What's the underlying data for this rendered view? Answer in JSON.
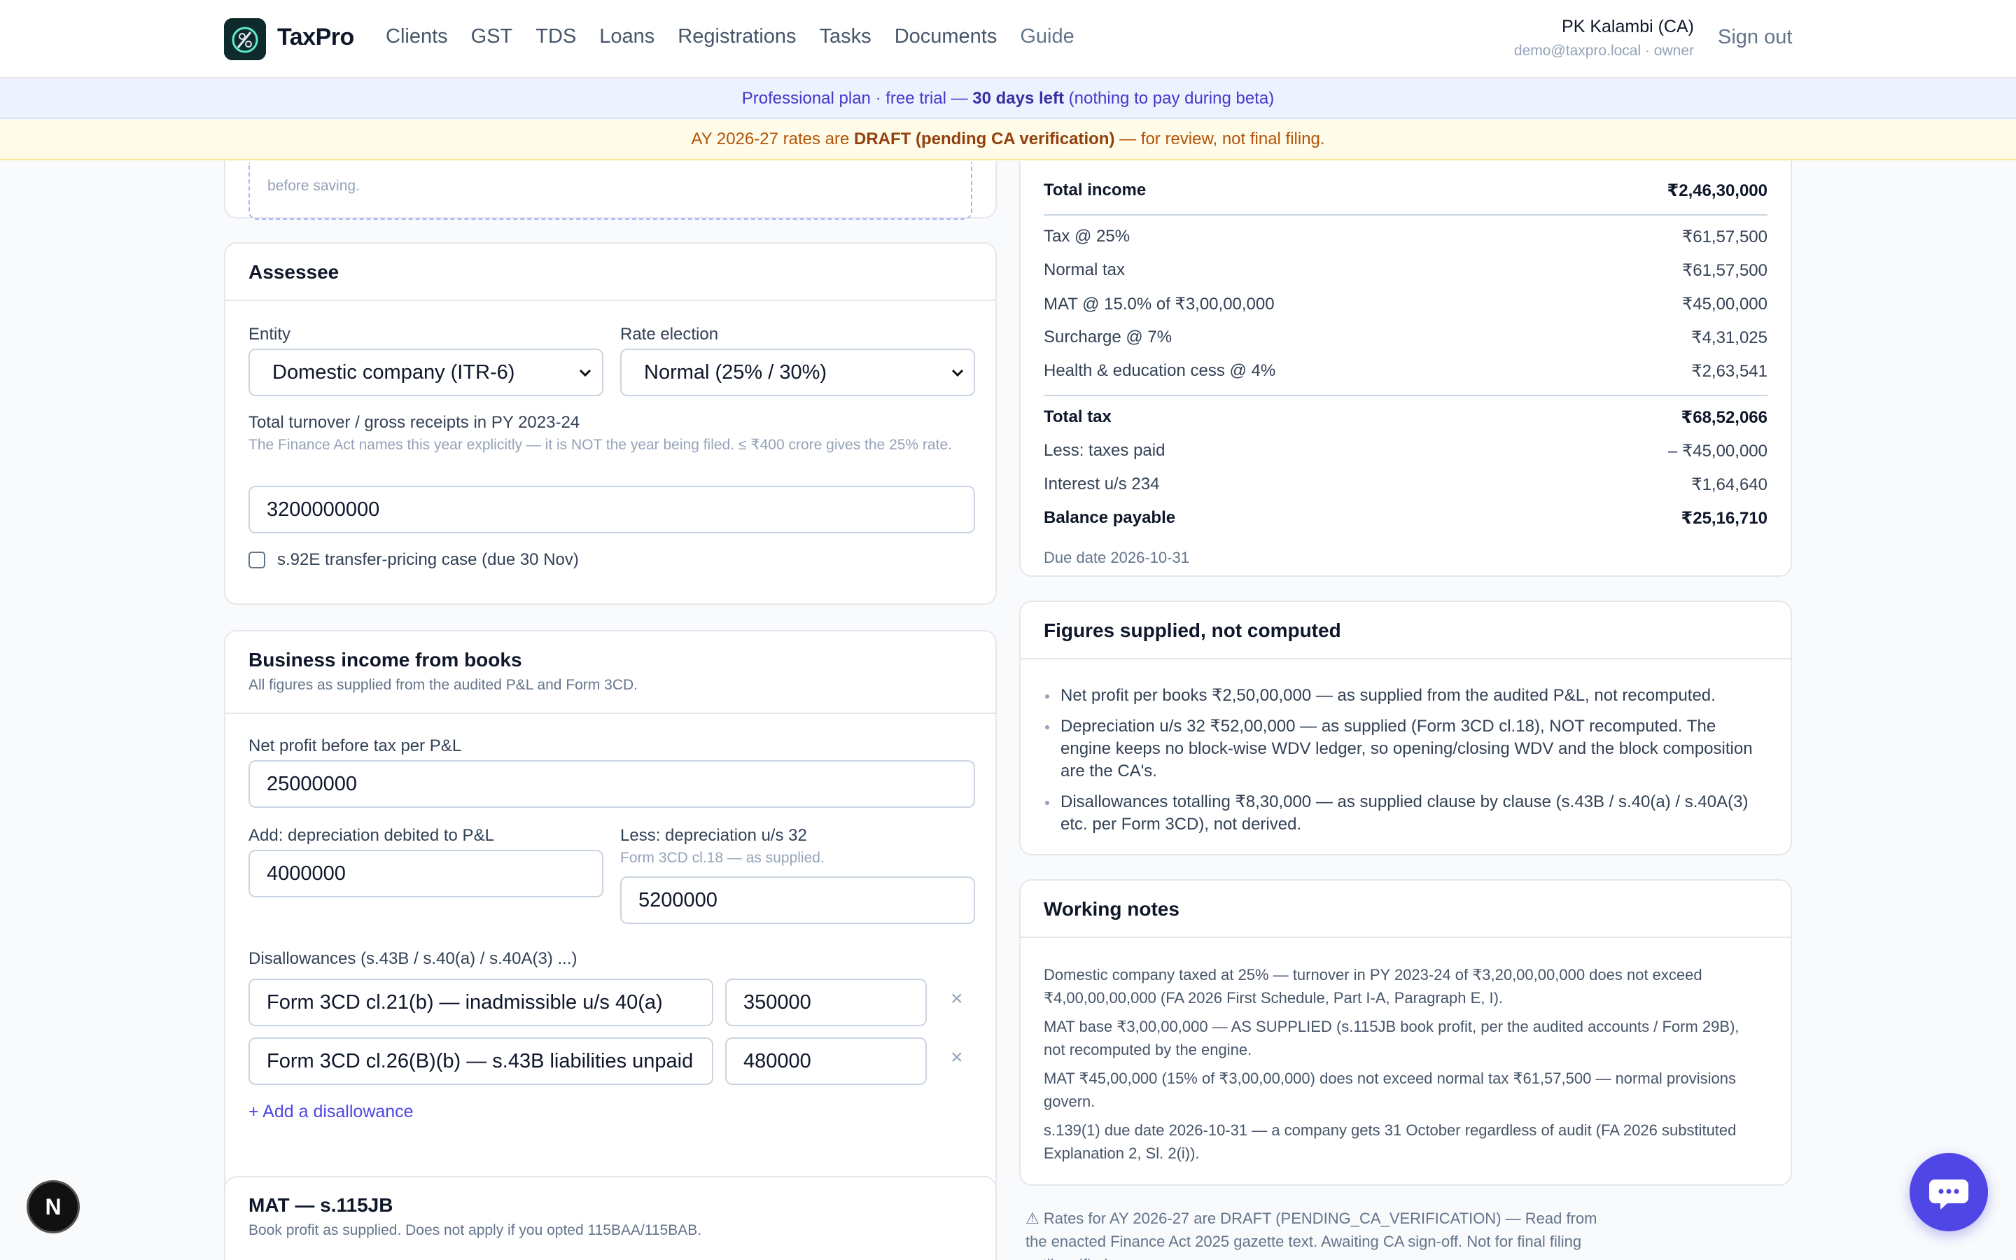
{
  "app": {
    "brand": "TaxPro"
  },
  "nav": {
    "items": [
      "Clients",
      "GST",
      "TDS",
      "Loans",
      "Registrations",
      "Tasks",
      "Documents",
      "Guide"
    ]
  },
  "user": {
    "name": "PK Kalambi (CA)",
    "email": "demo@taxpro.local · owner",
    "signout": "Sign out"
  },
  "banners": {
    "plan_prefix": "Professional plan · free trial — ",
    "plan_days": "30 days left",
    "plan_suffix": " (nothing to pay during beta)",
    "draft_prefix": "AY 2026-27 rates are ",
    "draft_bold": "DRAFT (pending CA verification)",
    "draft_suffix": " — for review, not final filing."
  },
  "top_card": {
    "cut_text": "before saving."
  },
  "assessee": {
    "title": "Assessee",
    "entity_label": "Entity",
    "entity_value": "Domestic company (ITR-6)",
    "rate_label": "Rate election",
    "rate_value": "Normal (25% / 30%)",
    "turnover_label": "Total turnover / gross receipts in PY 2023-24",
    "turnover_hint": "The Finance Act names this year explicitly — it is NOT the year being filed. ≤ ₹400 crore gives the 25% rate.",
    "turnover_value": "3200000000",
    "tp_label": "s.92E transfer-pricing case (due 30 Nov)"
  },
  "business": {
    "title": "Business income from books",
    "subtitle": "All figures as supplied from the audited P&L and Form 3CD.",
    "net_profit_label": "Net profit before tax per P&L",
    "net_profit_value": "25000000",
    "add_dep_label": "Add: depreciation debited to P&L",
    "add_dep_value": "4000000",
    "less_dep_label": "Less: depreciation u/s 32",
    "less_dep_hint": "Form 3CD cl.18 — as supplied.",
    "less_dep_value": "5200000",
    "disallow_label": "Disallowances (s.43B / s.40(a) / s.40A(3) ...)",
    "disallowances": [
      {
        "desc": "Form 3CD cl.21(b) — inadmissible u/s 40(a)",
        "amount": "350000"
      },
      {
        "desc": "Form 3CD cl.26(B)(b) — s.43B liabilities unpaid",
        "amount": "480000"
      }
    ],
    "remove_glyph": "×",
    "add_link": "+ Add a disallowance"
  },
  "mat": {
    "title": "MAT — s.115JB",
    "subtitle": "Book profit as supplied. Does not apply if you opted 115BAA/115BAB."
  },
  "computation": {
    "total_income": {
      "label": "Total income",
      "value": "₹2,46,30,000"
    },
    "rows": [
      {
        "label": "Tax @ 25%",
        "value": "₹61,57,500"
      },
      {
        "label": "Normal tax",
        "value": "₹61,57,500"
      },
      {
        "label": "MAT @ 15.0% of ₹3,00,00,000",
        "value": "₹45,00,000"
      },
      {
        "label": "Surcharge @ 7%",
        "value": "₹4,31,025"
      },
      {
        "label": "Health & education cess @ 4%",
        "value": "₹2,63,541"
      }
    ],
    "total_tax": {
      "label": "Total tax",
      "value": "₹68,52,066"
    },
    "taxes_paid": {
      "label": "Less: taxes paid",
      "value": "– ₹45,00,000"
    },
    "interest": {
      "label": "Interest u/s 234",
      "value": "₹1,64,640"
    },
    "balance": {
      "label": "Balance payable",
      "value": "₹25,16,710"
    },
    "due_date": "Due date 2026-10-31"
  },
  "supplied": {
    "title": "Figures supplied, not computed",
    "items": [
      "Net profit per books ₹2,50,00,000 — as supplied from the audited P&L, not recomputed.",
      "Depreciation u/s 32 ₹52,00,000 — as supplied (Form 3CD cl.18), NOT recomputed. The engine keeps no block-wise WDV ledger, so opening/closing WDV and the block composition are the CA's.",
      "Disallowances totalling ₹8,30,000 — as supplied clause by clause (s.43B / s.40(a) / s.40A(3) etc. per Form 3CD), not derived."
    ]
  },
  "working_notes": {
    "title": "Working notes",
    "notes": [
      "Domestic company taxed at 25% — turnover in PY 2023-24 of ₹3,20,00,00,000 does not exceed ₹4,00,00,00,000 (FA 2026 First Schedule, Part I-A, Paragraph E, I).",
      "MAT base ₹3,00,00,000 — AS SUPPLIED (s.115JB book profit, per the audited accounts / Form 29B), not recomputed by the engine.",
      "MAT ₹45,00,000 (15% of ₹3,00,00,000) does not exceed normal tax ₹61,57,500 — normal provisions govern.",
      "s.139(1) due date 2026-10-31 — a company gets 31 October regardless of audit (FA 2026 substituted Explanation 2, Sl. 2(i))."
    ]
  },
  "footer_note": "⚠ Rates for AY 2026-27 are DRAFT (PENDING_CA_VERIFICATION) — Read from the enacted Finance Act 2025 gazette text. Awaiting CA sign-off. Not for final filing until verified.",
  "dev_badge": "N",
  "colors": {
    "accent": "#4f46e5",
    "draft": "#92400e",
    "plan": "#4338ca"
  },
  "icons": {
    "logo": "taxpro-logo-icon",
    "chat": "chat-bubble-icon",
    "chevron": "chevron-down-icon"
  }
}
